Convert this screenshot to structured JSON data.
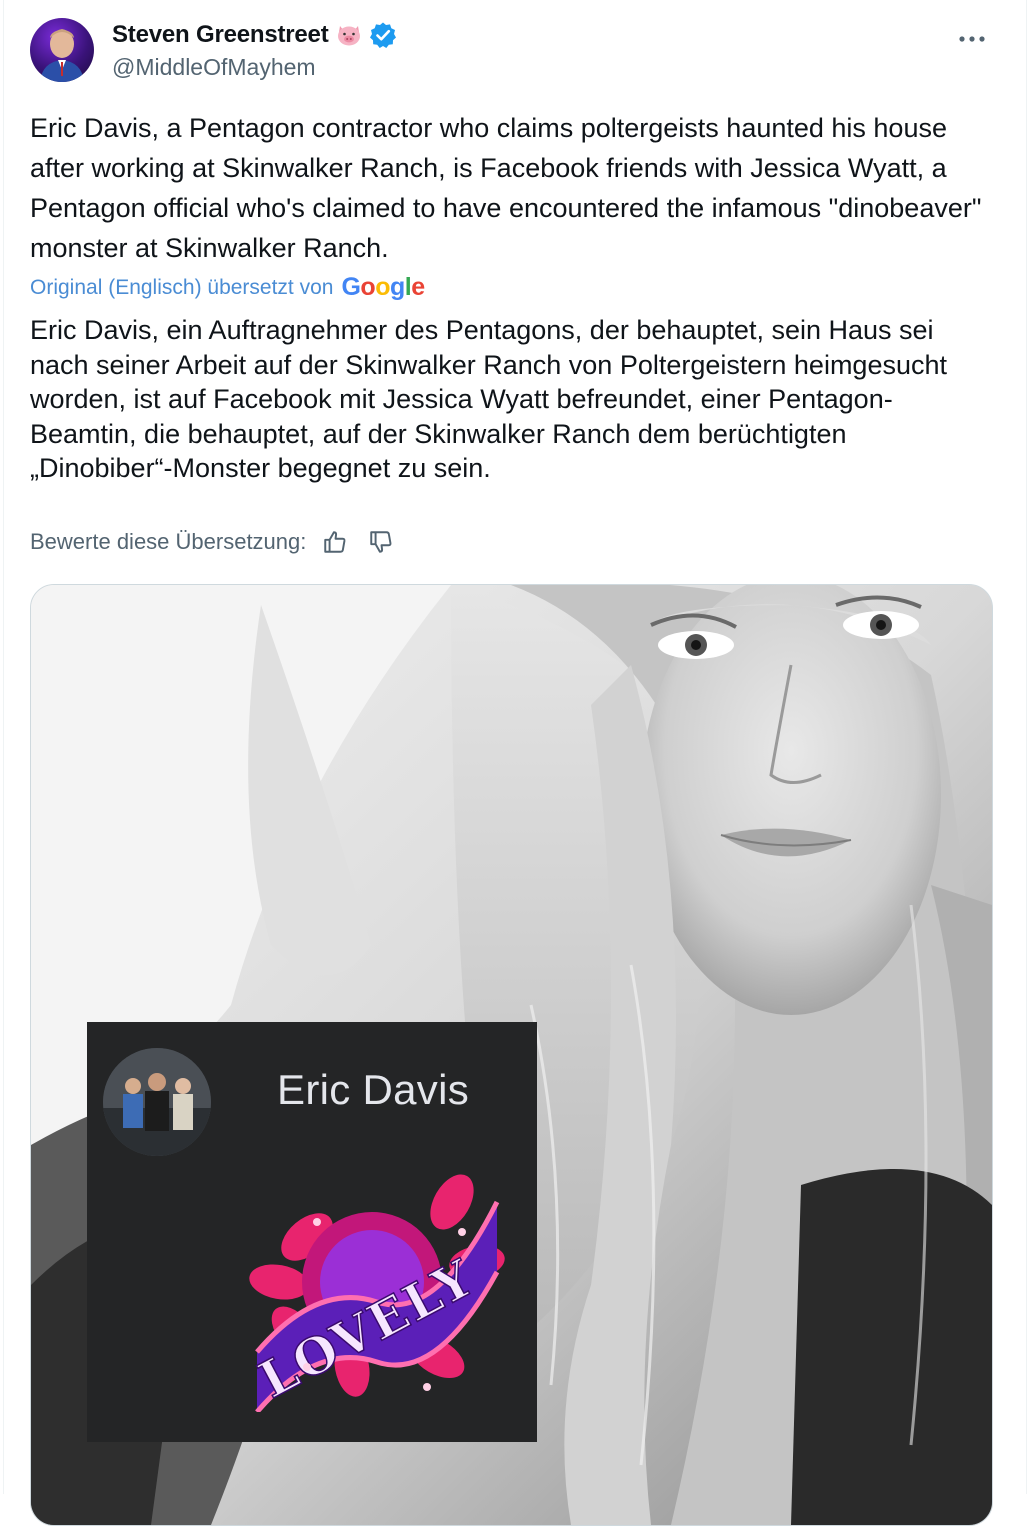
{
  "author": {
    "display_name": "Steven Greenstreet",
    "handle": "@MiddleOfMayhem",
    "badges": [
      "pig-icon",
      "verified-icon"
    ],
    "verified_color": "#1d9bf0"
  },
  "tweet": {
    "text": "Eric Davis, a Pentagon contractor who claims poltergeists haunted his house after working at Skinwalker Ranch, is Facebook friends with Jessica Wyatt, a Pentagon official who's claimed to have encountered the infamous \"dinobeaver\" monster at Skinwalker Ranch.",
    "translation_attribution": "Original (Englisch) übersetzt von",
    "translation_provider": "Google",
    "translated_text": "Eric Davis, ein Auftragnehmer des Pentagons, der behauptet, sein Haus sei nach seiner Arbeit auf der Skinwalker Ranch von Poltergeistern heimgesucht worden, ist auf Facebook mit Jessica Wyatt befreundet, einer Pentagon-Beamtin, die behauptet, auf der Skinwalker Ranch dem berüchtigten „Dinobiber“-Monster begegnet zu sein.",
    "rate_label": "Bewerte diese Übersetzung:"
  },
  "media": {
    "overlay_name": "Eric Davis",
    "sticker_text": "LOVELY"
  },
  "icons": {
    "more": "more-dots-icon",
    "thumbs_up": "thumbs-up-icon",
    "thumbs_down": "thumbs-down-icon"
  }
}
